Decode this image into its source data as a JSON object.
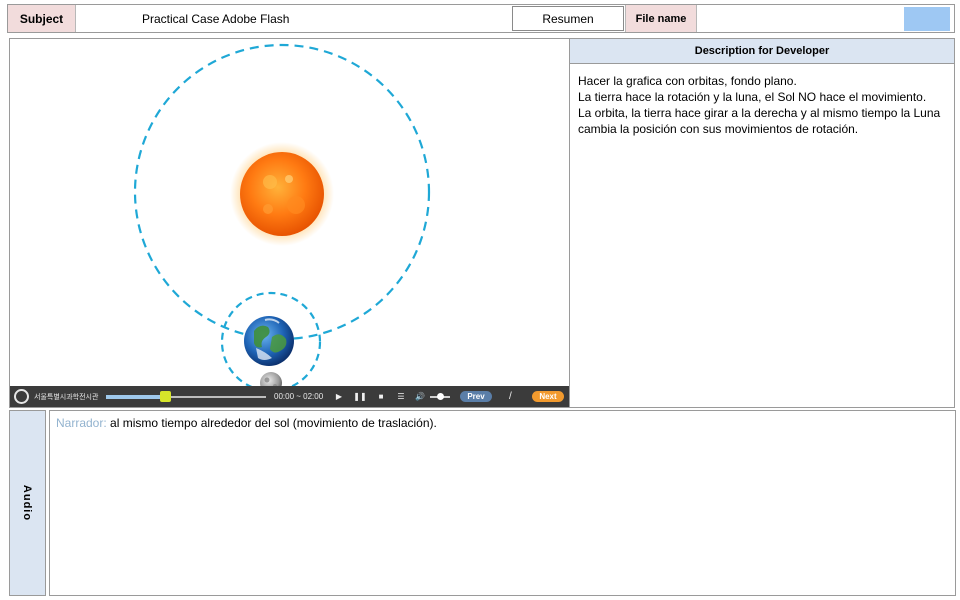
{
  "header": {
    "subject_label": "Subject",
    "subject_value": "Practical Case Adobe Flash",
    "resumen_label": "Resumen",
    "filename_label": "File name",
    "filename_value": "",
    "swatch_color": "#9ec8f3"
  },
  "scene": {
    "sun_icon": "sun-icon",
    "earth_icon": "earth-icon",
    "moon_icon": "moon-icon",
    "orbit_color": "#1fa8d6"
  },
  "player": {
    "brand": "서울특별시과학전시관",
    "time": "00:00 ~ 02:00",
    "progress_fraction": 0.37,
    "play_icon": "play-icon",
    "pause_icon": "pause-icon",
    "stop_icon": "stop-icon",
    "list_icon": "list-icon",
    "volume_icon": "volume-icon",
    "prev_label": "Prev",
    "separator": "/",
    "next_label": "Next"
  },
  "description": {
    "title": "Description for Developer",
    "lines": [
      "Hacer la grafica con orbitas, fondo plano.",
      "La tierra hace la rotación y la luna, el Sol NO hace el movimiento.",
      "La orbita,  la tierra hace girar a la derecha  y al mismo tiempo la Luna cambia la posición con sus movimientos de rotación."
    ]
  },
  "audio": {
    "label": "Audio",
    "narrator_label": "Narrador:",
    "narration": "al mismo tiempo alrededor del sol (movimiento de traslación)."
  }
}
